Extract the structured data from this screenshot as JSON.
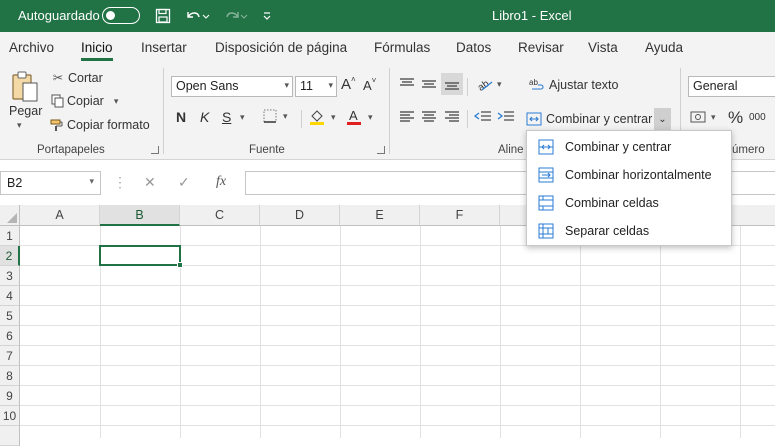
{
  "title_bar": {
    "autosave_label": "Autoguardado",
    "autosave_state": "off",
    "document": "Libro1 - Excel"
  },
  "tabs": [
    "Archivo",
    "Inicio",
    "Insertar",
    "Disposición de página",
    "Fórmulas",
    "Datos",
    "Revisar",
    "Vista",
    "Ayuda"
  ],
  "active_tab": "Inicio",
  "clipboard": {
    "paste": "Pegar",
    "cut": "Cortar",
    "copy": "Copiar",
    "format_painter": "Copiar formato",
    "group": "Portapapeles"
  },
  "font": {
    "name": "Open Sans",
    "size": "11",
    "grow": "A",
    "shrink": "A",
    "bold": "N",
    "italic": "K",
    "underline": "S",
    "group": "Fuente",
    "fill_color": "#ffd700",
    "font_color": "#e02020"
  },
  "alignment": {
    "wrap_text": "Ajustar texto",
    "merge_center": "Combinar y centrar",
    "group_partial": "Aline"
  },
  "number": {
    "format": "General",
    "percent": "%",
    "thousands": "000",
    "group_partial": "úmero"
  },
  "merge_menu": {
    "items": [
      {
        "label": "Combinar y centrar",
        "icon": "merge-center-icon"
      },
      {
        "label": "Combinar horizontalmente",
        "icon": "merge-across-icon"
      },
      {
        "label": "Combinar celdas",
        "icon": "merge-cells-icon"
      },
      {
        "label": "Separar celdas",
        "icon": "unmerge-cells-icon"
      }
    ]
  },
  "formula_bar": {
    "name_box": "B2",
    "fx": "fx",
    "formula": ""
  },
  "sheet": {
    "columns": [
      "A",
      "B",
      "C",
      "D",
      "E",
      "F"
    ],
    "rows": [
      "1",
      "2",
      "3",
      "4",
      "5",
      "6",
      "7",
      "8",
      "9",
      "10"
    ],
    "selected_cell": "B2"
  },
  "colors": {
    "accent": "#217346"
  }
}
